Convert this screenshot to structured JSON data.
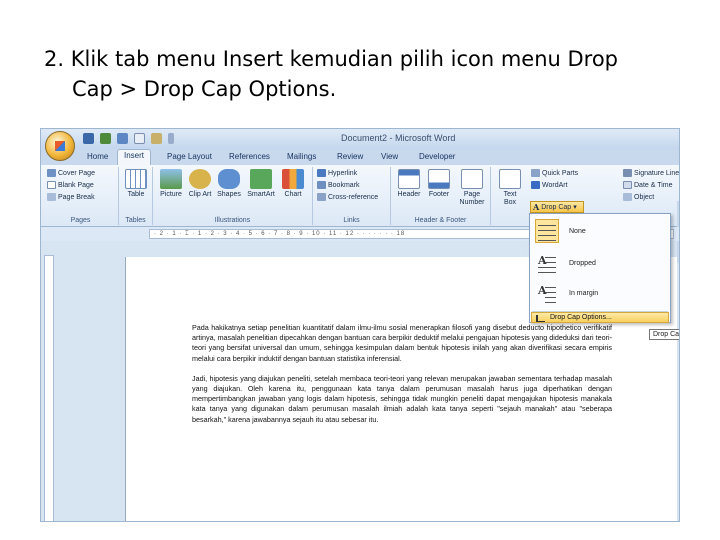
{
  "slide": {
    "line1": "2. Klik tab menu Insert kemudian pilih icon menu Drop",
    "line2": "Cap > Drop Cap Options."
  },
  "window": {
    "title": "Document2 - Microsoft Word"
  },
  "tabs": [
    "Home",
    "Insert",
    "Page Layout",
    "References",
    "Mailings",
    "Review",
    "View",
    "Developer"
  ],
  "active_tab": "Insert",
  "ribbon": {
    "pages": {
      "cover": "Cover Page",
      "blank": "Blank Page",
      "break": "Page Break",
      "label": "Pages"
    },
    "tables": {
      "table": "Table",
      "label": "Tables"
    },
    "illustrations": {
      "picture": "Picture",
      "clipart": "Clip Art",
      "shapes": "Shapes",
      "smartart": "SmartArt",
      "chart": "Chart",
      "label": "Illustrations"
    },
    "links": {
      "hyperlink": "Hyperlink",
      "bookmark": "Bookmark",
      "crossref": "Cross-reference",
      "label": "Links"
    },
    "header_footer": {
      "header": "Header",
      "footer": "Footer",
      "page_number": "Page Number",
      "label": "Header & Footer"
    },
    "text": {
      "textbox": "Text Box",
      "quickparts": "Quick Parts",
      "wordart": "WordArt",
      "dropcap": "Drop Cap",
      "signature": "Signature Line",
      "datetime": "Date & Time",
      "object": "Object"
    }
  },
  "ruler_marks": "· 2 · 1 · ⌶ · 1 · 2 · 3 · 4 · 5 · 6 · 7 · 8 · 9 · 10 · 11 · 12 · · · · · · · 18",
  "dropcap_menu": {
    "none": "None",
    "dropped": "Dropped",
    "in_margin": "In margin",
    "options": "Drop Cap Options..."
  },
  "tooltip": "Drop Cap Options",
  "document": {
    "p1": "Pada hakikatnya setiap penelitian kuantitatif dalam ilmu-ilmu sosial menerapkan filosofi yang disebut deducto hipothetico verifikatif artinya, masalah penelitian dipecahkan dengan bantuan cara berpikir deduktif melalui pengajuan hipotesis yang dideduksi dari teori-teori yang bersifat universal dan umum, sehingga kesimpulan dalam bentuk hipotesis inilah yang akan diverifikasi secara empiris melalui cara berpikir induktif dengan bantuan statistika inferensial.",
    "p2": "Jadi, hipotesis yang diajukan peneliti, setelah membaca teori-teori yang relevan merupakan jawaban sementara terhadap masalah yang diajukan. Oleh karena itu, penggunaan kata tanya dalam perumusan masalah harus juga diperhatikan dengan mempertimbangkan jawaban yang logis dalam hipotesis, sehingga tidak mungkin peneliti dapat mengajukan hipotesis manakala kata tanya yang digunakan dalam perumusan masalah ilmiah adalah kata tanya seperti \"sejauh manakah\" atau \"seberapa besarkah,\" karena jawabannya sejauh itu atau sebesar itu."
  },
  "colors": {
    "ribbon": "#dce8f6",
    "highlight": "#f8cf5e",
    "page": "#ffffff"
  }
}
